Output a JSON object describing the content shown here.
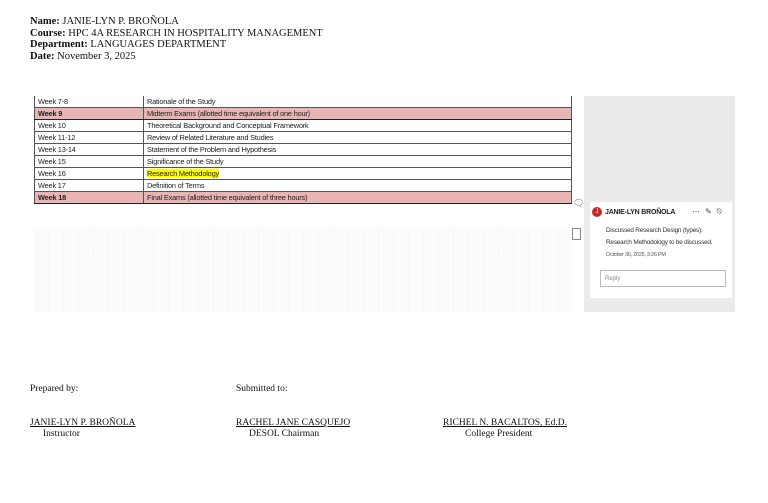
{
  "header": {
    "name_label": "Name:",
    "name": "JANIE-LYN P. BROÑOLA",
    "course_label": "Course:",
    "course": "HPC 4A RESEARCH IN HOSPITALITY MANAGEMENT",
    "department_label": "Department:",
    "department": "LANGUAGES DEPARTMENT",
    "date_label": "Date:",
    "date": "November 3, 2025"
  },
  "schedule": [
    {
      "week": "Week 7-8",
      "topic": "Rationale of the Study"
    },
    {
      "week": "Week 9",
      "topic": "Midterm Exams (allotted time equivalent of one hour)"
    },
    {
      "week": "Week 10",
      "topic": "Theoretical Background and Conceptual Framework"
    },
    {
      "week": "Week 11-12",
      "topic": "Review of Related Literature and Studies"
    },
    {
      "week": "Week 13-14",
      "topic": "Statement of the Problem and Hypothesis"
    },
    {
      "week": "Week 15",
      "topic": "Significance of the Study"
    },
    {
      "week": "Week 16",
      "topic": "Research Methodology"
    },
    {
      "week": "Week 17",
      "topic": "Definition of Terms"
    },
    {
      "week": "Week 18",
      "topic": "Final Exams (allotted time equivalent of three hours)"
    }
  ],
  "comment": {
    "author": "JANIE-LYN BROÑOLA",
    "avatar_initial": "J",
    "text": "Discussed Research Design (types); Research Methodology to be discussed.",
    "timestamp": "October 30, 2025, 3:26 PM",
    "reply_placeholder": "Reply",
    "more_icon": "⋯",
    "edit_icon": "✎",
    "attach_icon": "⍉"
  },
  "signatures": {
    "prepared_label": "Prepared by:",
    "submitted_label": "Submitted to:",
    "instructor_name": "JANIE-LYN P. BROÑOLA",
    "instructor_role": "Instructor",
    "chair_name": "RACHEL JANE CASQUEJO",
    "chair_role": "DESOL Chairman",
    "president_name": "RICHEL N. BACALTOS, Ed.D.",
    "president_role": "College President"
  },
  "colors": {
    "exam_row": "#e8b4b4",
    "highlight": "#ffff00",
    "avatar": "#c62828",
    "comment_panel": "#ebebeb"
  }
}
